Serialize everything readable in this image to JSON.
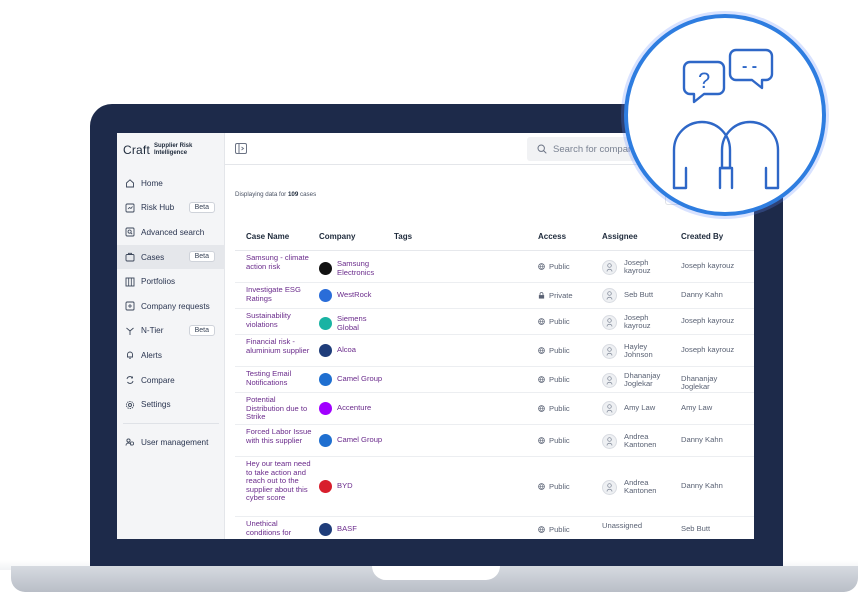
{
  "brand": {
    "name": "Craft",
    "tagline_line1": "Supplier Risk",
    "tagline_line2": "Intelligence"
  },
  "sidebar": {
    "items": [
      {
        "label": "Home",
        "icon": "home-icon",
        "badge": "",
        "active": false
      },
      {
        "label": "Risk Hub",
        "icon": "risk-hub-icon",
        "badge": "Beta",
        "active": false
      },
      {
        "label": "Advanced search",
        "icon": "advanced-search-icon",
        "badge": "",
        "active": false
      },
      {
        "label": "Cases",
        "icon": "cases-icon",
        "badge": "Beta",
        "active": true
      },
      {
        "label": "Portfolios",
        "icon": "portfolios-icon",
        "badge": "",
        "active": false
      },
      {
        "label": "Company requests",
        "icon": "add-request-icon",
        "badge": "",
        "active": false
      },
      {
        "label": "N-Tier",
        "icon": "n-tier-icon",
        "badge": "Beta",
        "active": false
      },
      {
        "label": "Alerts",
        "icon": "bell-icon",
        "badge": "",
        "active": false
      },
      {
        "label": "Compare",
        "icon": "compare-icon",
        "badge": "",
        "active": false
      },
      {
        "label": "Settings",
        "icon": "gear-icon",
        "badge": "",
        "active": false
      }
    ],
    "bottom_item": {
      "label": "User management",
      "icon": "users-icon"
    }
  },
  "search": {
    "placeholder": "Search for compan"
  },
  "summary": {
    "prefix": "Displaying data for ",
    "count": "109",
    "suffix": " cases"
  },
  "table": {
    "headers": [
      "Case Name",
      "Company",
      "Tags",
      "Access",
      "Assignee",
      "Created By"
    ],
    "rows": [
      {
        "case": "Samsung - climate action risk",
        "company": "Samsung Electronics",
        "logo_color": "#111111",
        "access": "Public",
        "assignee": "Joseph kayrouz",
        "created_by": "Joseph kayrouz"
      },
      {
        "case": "Investigate ESG Ratings",
        "company": "WestRock",
        "logo_color": "#2a6dd9",
        "access": "Private",
        "assignee": "Seb Butt",
        "created_by": "Danny Kahn"
      },
      {
        "case": "Sustainability violations",
        "company": "Siemens Global",
        "logo_color": "#19b3a3",
        "access": "Public",
        "assignee": "Joseph kayrouz",
        "created_by": "Joseph kayrouz"
      },
      {
        "case": "Financial risk - aluminium supplier",
        "company": "Alcoa",
        "logo_color": "#1f3d7a",
        "access": "Public",
        "assignee": "Hayley Johnson",
        "created_by": "Joseph kayrouz"
      },
      {
        "case": "Testing Email Notifications",
        "company": "Camel Group",
        "logo_color": "#1f6fd0",
        "access": "Public",
        "assignee": "Dhananjay Joglekar",
        "created_by": "Dhananjay Joglekar"
      },
      {
        "case": "Potential Distribution due to Strike",
        "company": "Accenture",
        "logo_color": "#a100ff",
        "access": "Public",
        "assignee": "Amy Law",
        "created_by": "Amy Law"
      },
      {
        "case": "Forced Labor Issue with this supplier",
        "company": "Camel Group",
        "logo_color": "#1f6fd0",
        "access": "Public",
        "assignee": "Andrea Kantonen",
        "created_by": "Danny Kahn"
      },
      {
        "case": "Hey our team need to take action and reach out to the supplier about this cyber score",
        "company": "BYD",
        "logo_color": "#d81e2c",
        "access": "Public",
        "assignee": "Andrea Kantonen",
        "created_by": "Danny Kahn"
      },
      {
        "case": "Unethical conditions for",
        "company": "BASF",
        "logo_color": "#1f3d7a",
        "access": "Public",
        "assignee": "Unassigned",
        "created_by": "Seb Butt"
      }
    ]
  },
  "overlay": {
    "icon": "two-people-chat-icon",
    "question_mark": "?",
    "dashes": "- -",
    "ring_color": "#2e7de0"
  }
}
